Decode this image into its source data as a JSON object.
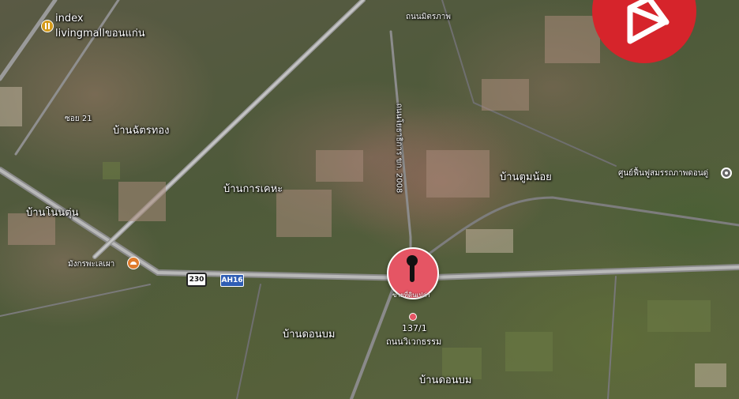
{
  "map": {
    "labels": {
      "index_line1": "index",
      "index_line2": "livingmallขอนแก่น",
      "ban_chattong": "บ้านฉัตรทอง",
      "ban_karnkeha": "บ้านการเคหะ",
      "ban_nontun": "บ้านโนนตุ่น",
      "ban_tumnoi": "บ้านตูมน้อย",
      "center_poi": "ศูนย์ฟื้นฟูสมรรถภาพดอนดู่",
      "mangkorn": "มังกรพะเลเผา",
      "ban_donbom_1": "บ้านดอนบม",
      "ban_donbom_2": "บ้านดอนบม",
      "vertical_road": "ถนนโยธาธิการ ขก. 2008",
      "soi_small": "ซอย 21",
      "top_road": "ถนนมิตรภาพ"
    },
    "shields": {
      "route_230": "230",
      "route_ah16": "AH16"
    },
    "pin": {
      "label": "ขายที่ดินเปล่า",
      "address_line1": "137/1",
      "address_line2": "ถนนวิเวกธรรม"
    },
    "icons": {
      "shopping": "shopping-bag-icon",
      "food": "restaurant-icon",
      "poi": "place-icon",
      "pin": "location-pin-icon",
      "logo": "brand-logo-icon"
    },
    "colors": {
      "pin": "#e55564",
      "logo": "#d6242b",
      "route_ah": "#2f5db4"
    }
  }
}
